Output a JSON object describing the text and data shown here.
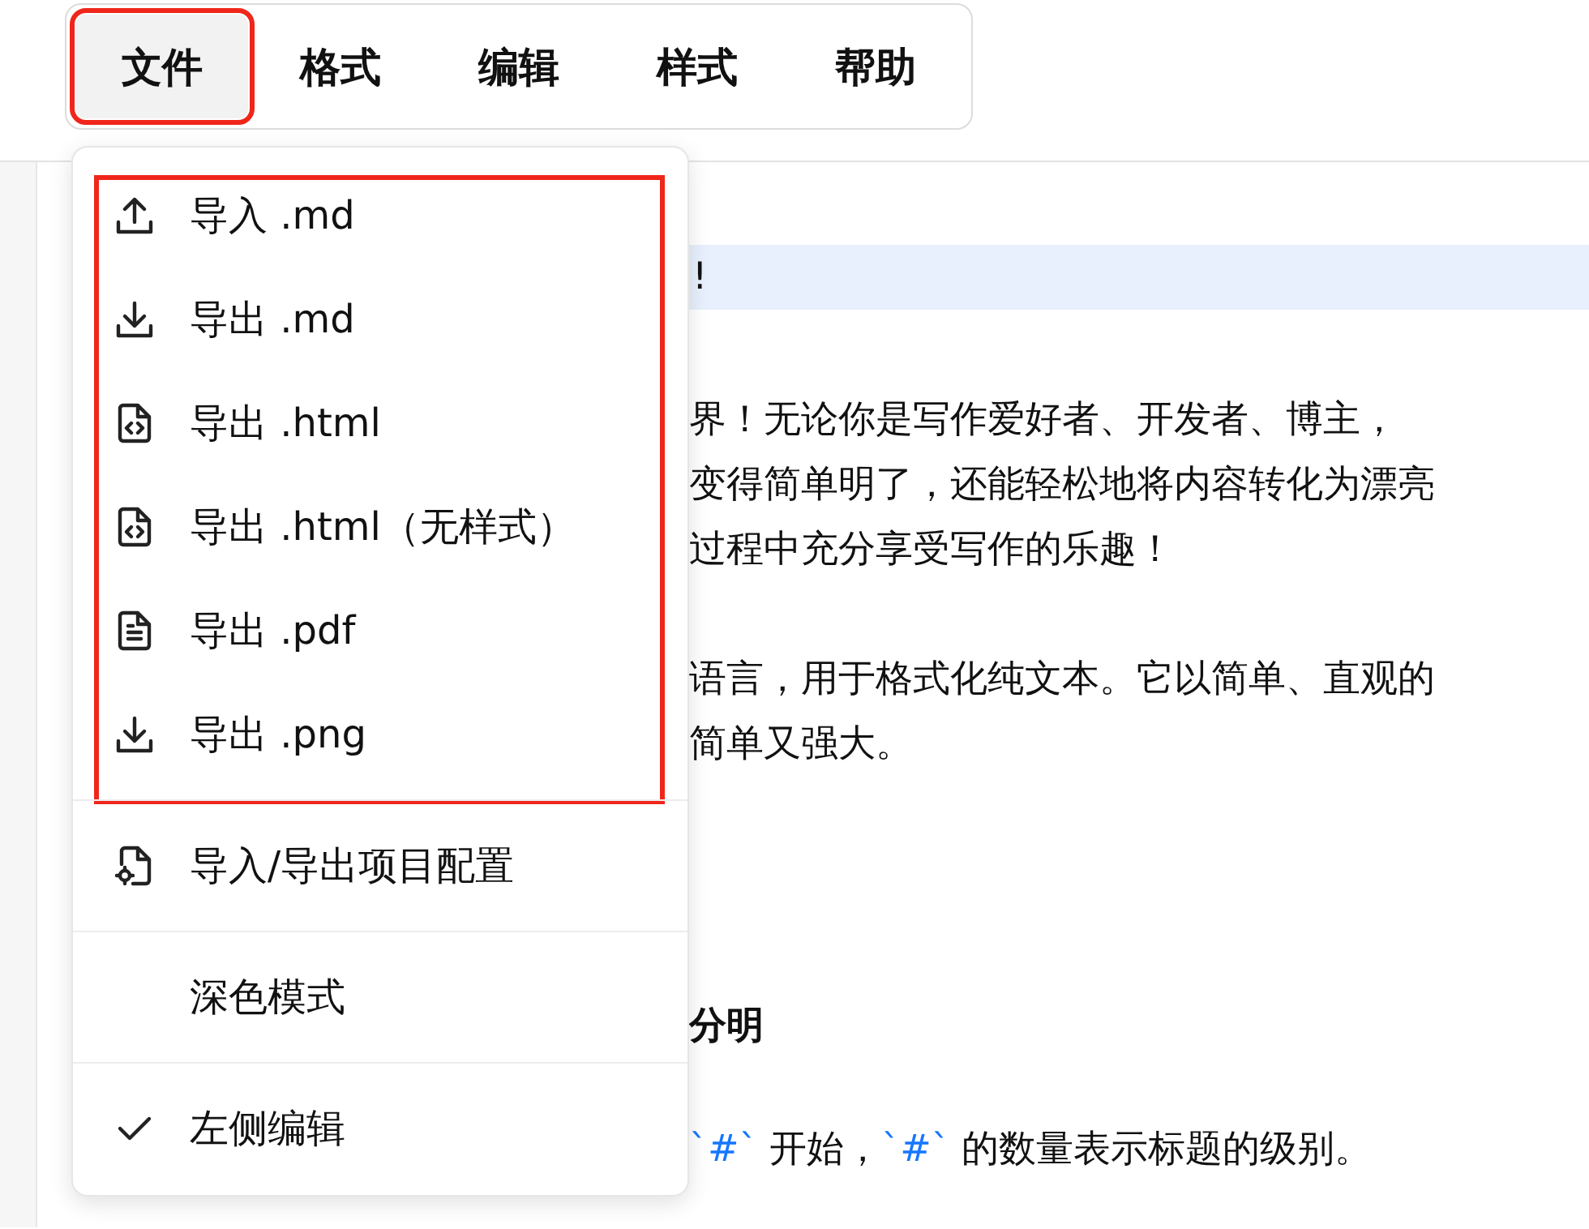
{
  "menubar": {
    "items": [
      {
        "label": "文件",
        "selected": true,
        "highlighted": true
      },
      {
        "label": "格式",
        "selected": false,
        "highlighted": false
      },
      {
        "label": "编辑",
        "selected": false,
        "highlighted": false
      },
      {
        "label": "样式",
        "selected": false,
        "highlighted": false
      },
      {
        "label": "帮助",
        "selected": false,
        "highlighted": false
      }
    ]
  },
  "menu": {
    "sections": [
      {
        "highlighted": true,
        "items": [
          {
            "kind": "upload",
            "label": "导入 .md"
          },
          {
            "kind": "download",
            "label": "导出 .md"
          },
          {
            "kind": "code-file",
            "label": "导出 .html"
          },
          {
            "kind": "code-file",
            "label": "导出 .html（无样式）"
          },
          {
            "kind": "text-file",
            "label": "导出 .pdf"
          },
          {
            "kind": "download",
            "label": "导出 .png"
          }
        ]
      },
      {
        "items": [
          {
            "kind": "gear-file",
            "label": "导入/导出项目配置"
          }
        ]
      },
      {
        "items": [
          {
            "kind": "toggle",
            "label": "深色模式",
            "checked": false
          }
        ]
      },
      {
        "items": [
          {
            "kind": "toggle",
            "label": "左侧编辑",
            "checked": true
          }
        ]
      }
    ]
  },
  "editor": {
    "blocks": [
      {
        "kind": "highlight",
        "lines": [
          [
            {
              "text": "!"
            }
          ]
        ]
      },
      {
        "kind": "paragraph",
        "lines": [
          [
            {
              "text": "界！无论你是写作爱好者、开发者、博主，"
            }
          ],
          [
            {
              "text": "变得简单明了，还能轻松地将内容转化为漂亮"
            }
          ],
          [
            {
              "text": "过程中充分享受写作的乐趣！"
            }
          ]
        ]
      },
      {
        "kind": "paragraph2",
        "lines": [
          [
            {
              "text": "语言，用于格式化纯文本。它以简单、直观的"
            }
          ],
          [
            {
              "text": "简单又强大。"
            }
          ]
        ]
      },
      {
        "kind": "heading",
        "lines": [
          [
            {
              "text": "分明"
            }
          ]
        ]
      },
      {
        "kind": "paragraph3",
        "lines": [
          [
            {
              "text": "`#`",
              "code": true
            },
            {
              "text": " 开始，"
            },
            {
              "text": "`#`",
              "code": true
            },
            {
              "text": " 的数量表示标题的级别。"
            }
          ]
        ]
      }
    ]
  }
}
